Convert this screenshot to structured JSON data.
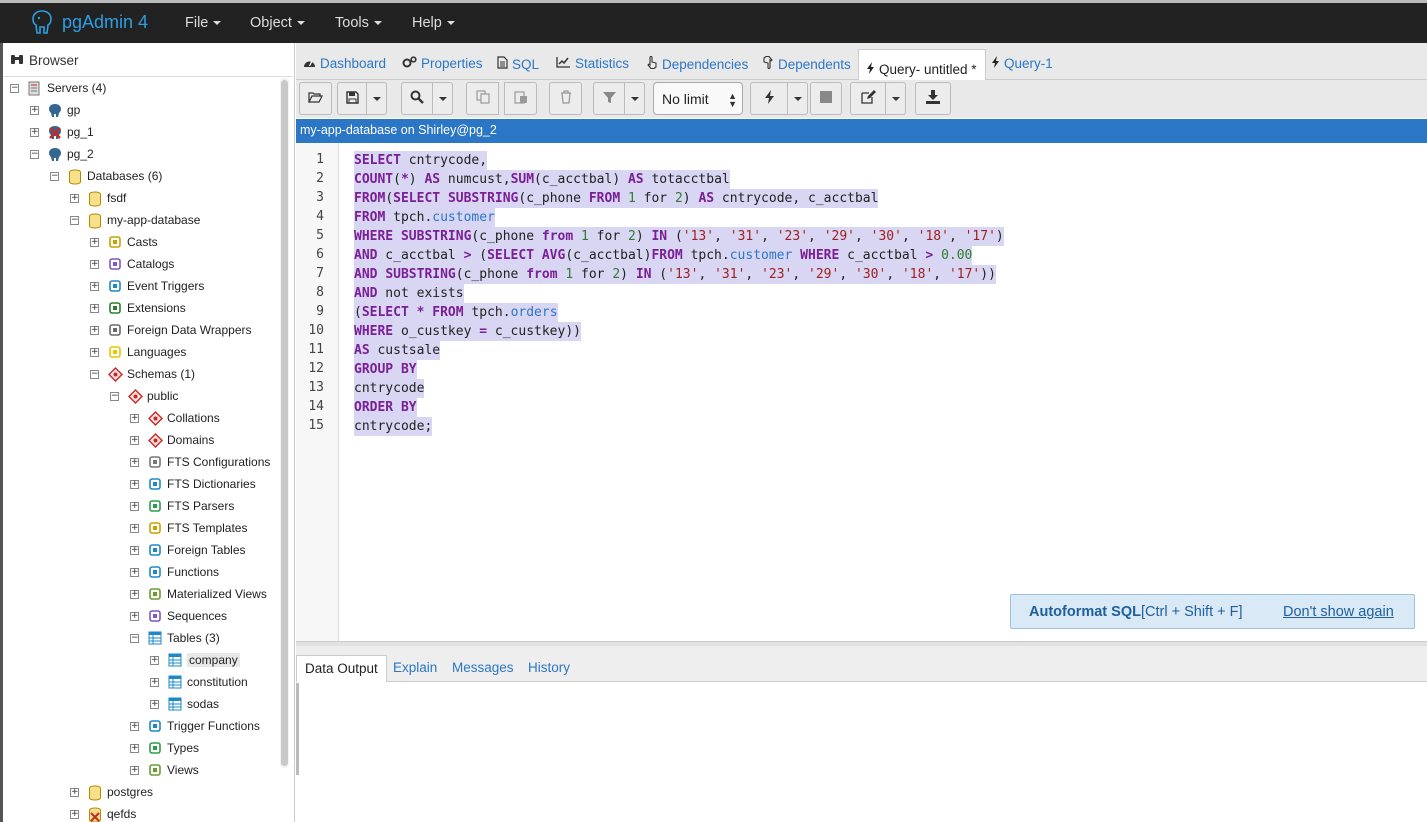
{
  "app": {
    "title": "pgAdmin 4"
  },
  "menu": {
    "file": "File",
    "object": "Object",
    "tools": "Tools",
    "help": "Help"
  },
  "browser": {
    "title": "Browser",
    "tree": [
      {
        "id": "servers",
        "label": "Servers (4)",
        "icon": "server-group-icon",
        "expanded": true,
        "depth": 0
      },
      {
        "id": "gp",
        "label": "gp",
        "icon": "elephant-icon",
        "expanded": false,
        "depth": 1
      },
      {
        "id": "pg-1",
        "label": "pg_1",
        "icon": "server-disconnected-icon",
        "expanded": false,
        "depth": 1
      },
      {
        "id": "pg-2",
        "label": "pg_2",
        "icon": "elephant-icon",
        "expanded": true,
        "depth": 1
      },
      {
        "id": "databases",
        "label": "Databases (6)",
        "icon": "database-group-icon",
        "expanded": true,
        "depth": 2
      },
      {
        "id": "fsdf",
        "label": "fsdf",
        "icon": "database-icon",
        "expanded": false,
        "depth": 3
      },
      {
        "id": "my-app-database",
        "label": "my-app-database",
        "icon": "database-icon",
        "expanded": true,
        "depth": 3
      },
      {
        "id": "casts",
        "label": "Casts",
        "icon": "casts-icon",
        "expanded": false,
        "depth": 4
      },
      {
        "id": "catalogs",
        "label": "Catalogs",
        "icon": "catalogs-icon",
        "expanded": false,
        "depth": 4
      },
      {
        "id": "event-triggers",
        "label": "Event Triggers",
        "icon": "event-trigger-icon",
        "expanded": false,
        "depth": 4
      },
      {
        "id": "extensions",
        "label": "Extensions",
        "icon": "extension-icon",
        "expanded": false,
        "depth": 4
      },
      {
        "id": "fdw",
        "label": "Foreign Data Wrappers",
        "icon": "fdw-icon",
        "expanded": false,
        "depth": 4
      },
      {
        "id": "languages",
        "label": "Languages",
        "icon": "language-icon",
        "expanded": false,
        "depth": 4
      },
      {
        "id": "schemas",
        "label": "Schemas (1)",
        "icon": "schema-group-icon",
        "expanded": true,
        "depth": 4
      },
      {
        "id": "public",
        "label": "public",
        "icon": "schema-icon",
        "expanded": true,
        "depth": 5
      },
      {
        "id": "collations",
        "label": "Collations",
        "icon": "collation-icon",
        "expanded": false,
        "depth": 6
      },
      {
        "id": "domains",
        "label": "Domains",
        "icon": "domain-icon",
        "expanded": false,
        "depth": 6
      },
      {
        "id": "fts-configurations",
        "label": "FTS Configurations",
        "icon": "fts-configuration-icon",
        "expanded": false,
        "depth": 6
      },
      {
        "id": "fts-dictionaries",
        "label": "FTS Dictionaries",
        "icon": "fts-dictionary-icon",
        "expanded": false,
        "depth": 6
      },
      {
        "id": "fts-parsers",
        "label": "FTS Parsers",
        "icon": "fts-parser-icon",
        "expanded": false,
        "depth": 6
      },
      {
        "id": "fts-templates",
        "label": "FTS Templates",
        "icon": "fts-template-icon",
        "expanded": false,
        "depth": 6
      },
      {
        "id": "foreign-tables",
        "label": "Foreign Tables",
        "icon": "foreign-table-icon",
        "expanded": false,
        "depth": 6
      },
      {
        "id": "functions",
        "label": "Functions",
        "icon": "function-icon",
        "expanded": false,
        "depth": 6
      },
      {
        "id": "materialized-views",
        "label": "Materialized Views",
        "icon": "materialized-view-icon",
        "expanded": false,
        "depth": 6
      },
      {
        "id": "sequences",
        "label": "Sequences",
        "icon": "sequence-icon",
        "expanded": false,
        "depth": 6
      },
      {
        "id": "tables",
        "label": "Tables (3)",
        "icon": "table-group-icon",
        "expanded": true,
        "depth": 6
      },
      {
        "id": "company",
        "label": "company",
        "icon": "table-icon",
        "expanded": false,
        "depth": 7,
        "selected": true
      },
      {
        "id": "constitution",
        "label": "constitution",
        "icon": "table-icon",
        "expanded": false,
        "depth": 7
      },
      {
        "id": "sodas",
        "label": "sodas",
        "icon": "table-icon",
        "expanded": false,
        "depth": 7
      },
      {
        "id": "trigger-functions",
        "label": "Trigger Functions",
        "icon": "trigger-function-icon",
        "expanded": false,
        "depth": 6
      },
      {
        "id": "types",
        "label": "Types",
        "icon": "type-icon",
        "expanded": false,
        "depth": 6
      },
      {
        "id": "views",
        "label": "Views",
        "icon": "view-icon",
        "expanded": false,
        "depth": 6
      },
      {
        "id": "postgres",
        "label": "postgres",
        "icon": "database-icon",
        "expanded": false,
        "depth": 3
      },
      {
        "id": "qefds",
        "label": "qefds",
        "icon": "database-disconnected-icon",
        "expanded": false,
        "depth": 3
      }
    ]
  },
  "tabs": {
    "dashboard": "Dashboard",
    "properties": "Properties",
    "sql": "SQL",
    "statistics": "Statistics",
    "dependencies": "Dependencies",
    "dependents": "Dependents",
    "query_untitled": "Query- untitled *",
    "query_1": "Query-1"
  },
  "toolbar": {
    "limit_value": "No limit"
  },
  "connection": {
    "label": "my-app-database on Shirley@pg_2"
  },
  "editor": {
    "line_numbers": [
      "1",
      "2",
      "3",
      "4",
      "5",
      "6",
      "7",
      "8",
      "9",
      "10",
      "11",
      "12",
      "13",
      "14",
      "15"
    ]
  },
  "autoformat": {
    "title": "Autoformat SQL",
    "shortcut": "[Ctrl + Shift + F]",
    "dismiss": "Don't show again"
  },
  "results": {
    "tabs": {
      "data_output": "Data Output",
      "explain": "Explain",
      "messages": "Messages",
      "history": "History"
    }
  },
  "colors": {
    "accent": "#2c76c6",
    "topbar": "#222222",
    "keyword": "#7a1f96",
    "string": "#a02020",
    "number": "#2e7d32",
    "selection": "#d8d6f2"
  }
}
